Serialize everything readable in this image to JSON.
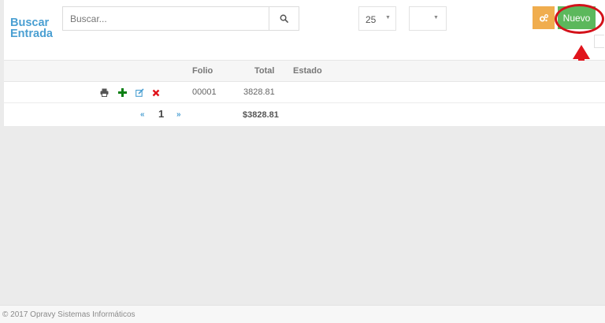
{
  "header": {
    "title_line1": "Buscar",
    "title_line2": "Entrada"
  },
  "search": {
    "placeholder": "Buscar...",
    "value": ""
  },
  "page_size": {
    "selected": "25"
  },
  "filter": {
    "selected": ""
  },
  "actions": {
    "new_label": "Nuevo"
  },
  "colors": {
    "accent": "#4a9fd2",
    "new_button": "#5cb85c",
    "gear_button": "#f0ad4e",
    "highlight": "#d3121a"
  },
  "table": {
    "headers": {
      "folio": "Folio",
      "total": "Total",
      "estado": "Estado"
    },
    "rows": [
      {
        "folio": "00001",
        "total": "3828.81",
        "estado": "",
        "icons": [
          "print-icon",
          "add-icon",
          "edit-icon",
          "delete-icon"
        ]
      }
    ]
  },
  "pagination": {
    "first": "«",
    "current": "1",
    "last": "»"
  },
  "totals": {
    "sum": "$3828.81"
  },
  "footer": {
    "text": "© 2017 Opravy Sistemas Informáticos"
  }
}
